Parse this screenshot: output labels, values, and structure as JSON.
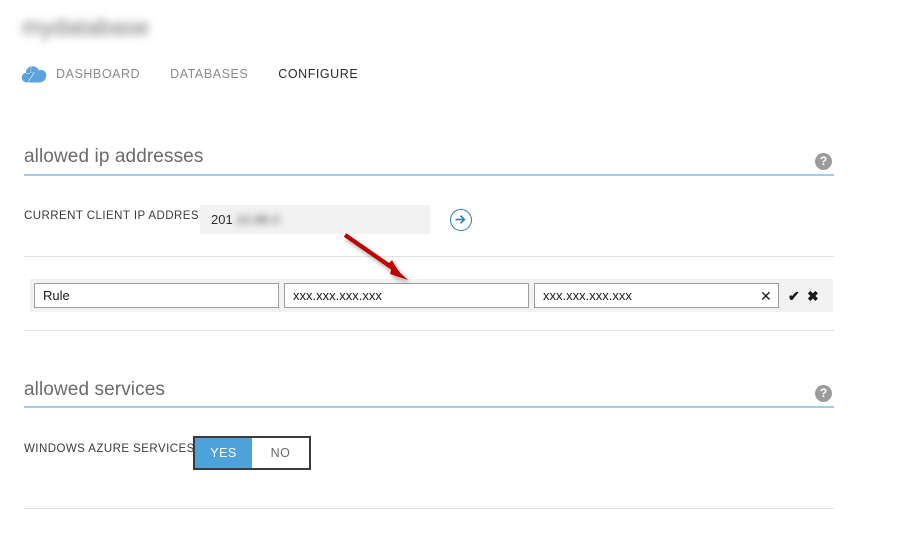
{
  "header": {
    "resource_title": "mydatabase",
    "service_icon": "sql-database-cloud-icon",
    "tabs": [
      {
        "label": "DASHBOARD",
        "active": false
      },
      {
        "label": "DATABASES",
        "active": false
      },
      {
        "label": "CONFIGURE",
        "active": true
      }
    ]
  },
  "sections": {
    "allowed_ip": {
      "title": "allowed ip addresses",
      "help_icon": "help-question-icon",
      "current_ip": {
        "label": "CURRENT CLIENT IP ADDRESS",
        "value_visible": "201",
        "value_hidden": ".10.88.0",
        "add_button_icon": "arrow-right-circle-icon"
      },
      "rule_row": {
        "name_value": "Rule",
        "start_ip_value": "xxx.xxx.xxx.xxx",
        "end_ip_value": "xxx.xxx.xxx.xxx",
        "name_placeholder": "Rule",
        "ip_placeholder": "xxx.xxx.xxx.xxx",
        "clear_icon": "clear-x-icon",
        "confirm_icon": "checkmark-icon",
        "cancel_icon": "close-x-icon"
      }
    },
    "allowed_services": {
      "title": "allowed services",
      "help_icon": "help-question-icon",
      "windows_azure_services": {
        "label": "WINDOWS AZURE SERVICES",
        "options": [
          {
            "label": "YES",
            "selected": true
          },
          {
            "label": "NO",
            "selected": false
          }
        ]
      }
    }
  },
  "annotation": {
    "arrow_color": "#c00000",
    "points_to": "start-ip-input"
  },
  "colors": {
    "accent_blue": "#4ea2dc",
    "section_rule": "#a5c9e6",
    "row_background": "#f2f2f2",
    "divider": "#e2e2e2",
    "annotation_red": "#c00000"
  }
}
